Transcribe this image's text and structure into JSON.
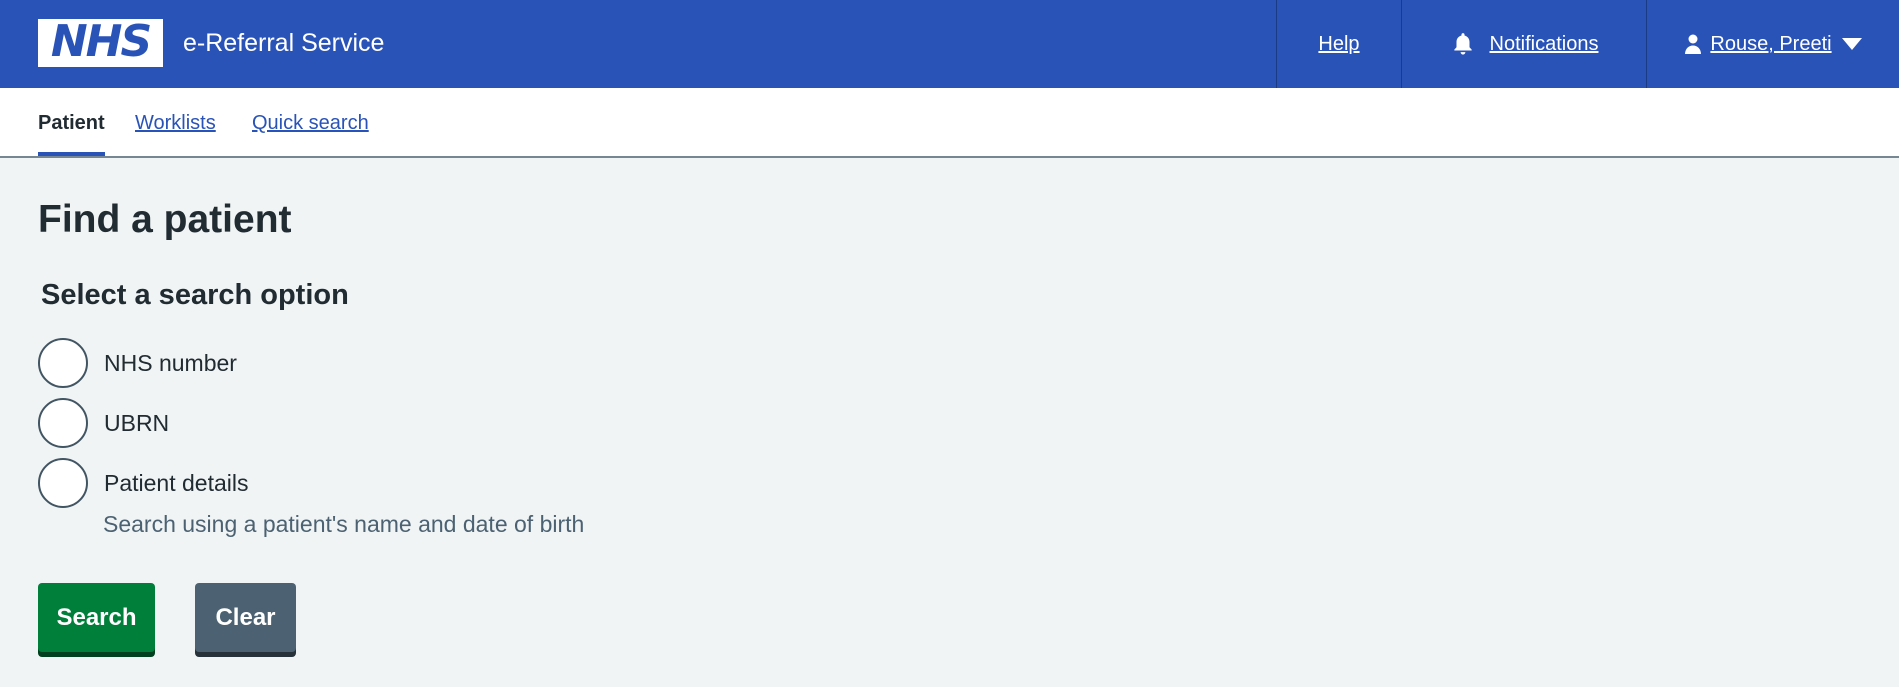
{
  "header": {
    "logo_text": "NHS",
    "service_name": "e-Referral Service",
    "help_label": "Help",
    "notifications_label": "Notifications",
    "user_name": "Rouse, Preeti"
  },
  "subnav": {
    "tabs": [
      {
        "label": "Patient",
        "active": true
      },
      {
        "label": "Worklists",
        "active": false
      },
      {
        "label": "Quick search",
        "active": false
      }
    ]
  },
  "main": {
    "title": "Find a patient",
    "legend": "Select a search option",
    "options": [
      {
        "label": "NHS number",
        "selected": false
      },
      {
        "label": "UBRN",
        "selected": false
      },
      {
        "label": "Patient details",
        "selected": false,
        "hint": "Search using a patient's name and date of birth"
      }
    ],
    "search_button": "Search",
    "clear_button": "Clear"
  },
  "colors": {
    "header_blue": "#2a53b8",
    "page_background": "#f0f4f5",
    "search_green": "#007f3b",
    "clear_grey": "#4c6272"
  },
  "icons": [
    "bell-icon",
    "user-icon",
    "chevron-down-icon"
  ]
}
